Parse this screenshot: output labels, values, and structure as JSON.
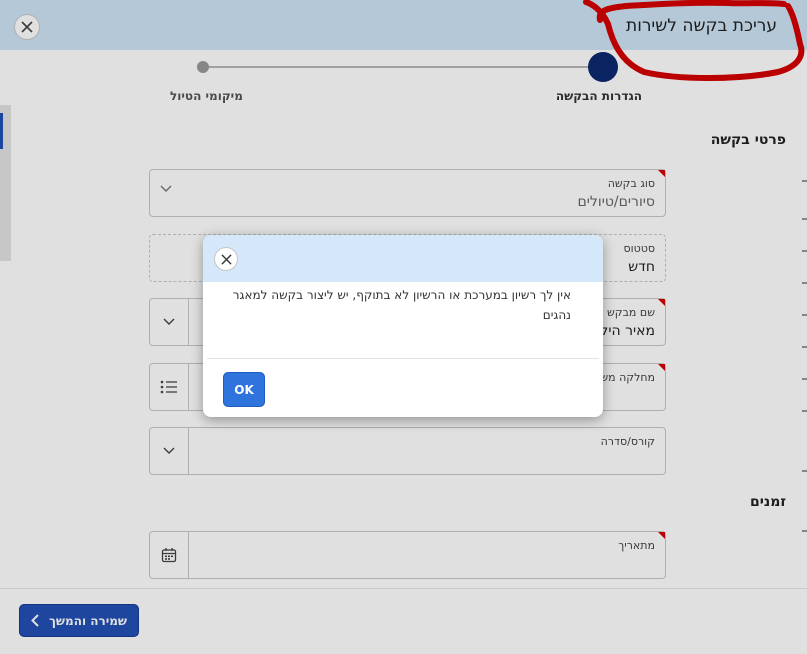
{
  "window": {
    "title": "עריכת בקשה לשירות",
    "close_label": "close"
  },
  "stepper": {
    "steps": [
      {
        "label": "הגדרות הבקשה",
        "active": true
      },
      {
        "label": "מיקומי הטיול",
        "active": false
      }
    ]
  },
  "sections": {
    "request_details": "פרטי בקשה",
    "times": "זמנים"
  },
  "form": {
    "request_type": {
      "label": "סוג בקשה",
      "value": "סיורים/טיולים"
    },
    "status": {
      "label": "סטטוס",
      "value": "חדש"
    },
    "requester": {
      "label": "שם מבקש",
      "value": "מאיר היל"
    },
    "department": {
      "label": "מחלקה משל",
      "value": ""
    },
    "course": {
      "label": "קורס/סדרה",
      "value": ""
    },
    "date": {
      "label": "מתאריך",
      "value": ""
    }
  },
  "footer": {
    "save_continue_label": "שמירה והמשך"
  },
  "modal": {
    "message": "אין לך רשיון במערכת או הרשיון לא בתוקף, יש ליצור בקשה למאגר נהגים",
    "ok_label": "OK"
  },
  "colors": {
    "header_bg": "#cfe4f6",
    "primary": "#2350b6",
    "active_step": "#0b2a6f",
    "required_marker": "#d40000",
    "annotation_scribble": "#d40000"
  }
}
